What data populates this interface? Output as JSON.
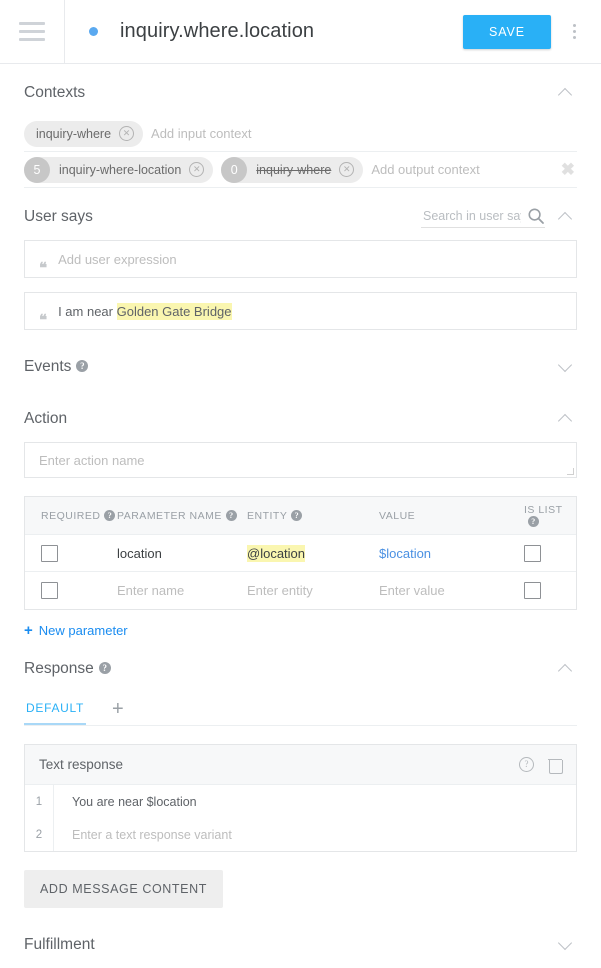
{
  "topbar": {
    "menu_icon": "hamburger-icon",
    "status_dot": "blue-dot",
    "title": "inquiry.where.location",
    "save_label": "SAVE",
    "more_icon": "kebab-menu-icon",
    "accent_color": "#29b0f6"
  },
  "contexts": {
    "title": "Contexts",
    "input_chips": [
      {
        "label": "inquiry-where",
        "badge": null,
        "strike": false
      }
    ],
    "input_placeholder": "Add input context",
    "output_chips": [
      {
        "label": "inquiry-where-location",
        "badge": "5",
        "strike": false
      },
      {
        "label": "inquiry-where",
        "badge": "0",
        "strike": true
      }
    ],
    "output_placeholder": "Add output context",
    "clear_icon": "close-icon"
  },
  "user_says": {
    "title": "User says",
    "search_placeholder": "Search in user says",
    "search_value": "",
    "add_expression_placeholder": "Add user expression",
    "expressions": [
      {
        "prefix": "I am near ",
        "highlight": "Golden Gate Bridge",
        "highlight_color": "#faf6b0"
      }
    ]
  },
  "events": {
    "title": "Events"
  },
  "action": {
    "title": "Action",
    "name_placeholder": "Enter action name",
    "name_value": "",
    "table": {
      "headers": [
        "REQUIRED",
        "PARAMETER NAME",
        "ENTITY",
        "VALUE",
        "IS LIST"
      ],
      "rows": [
        {
          "required": false,
          "name": "location",
          "name_is_placeholder": false,
          "entity": "@location",
          "entity_is_placeholder": false,
          "entity_highlight": true,
          "value": "$location",
          "value_is_placeholder": false,
          "value_is_link": true,
          "is_list": false
        },
        {
          "required": false,
          "name": "Enter name",
          "name_is_placeholder": true,
          "entity": "Enter entity",
          "entity_is_placeholder": true,
          "entity_highlight": false,
          "value": "Enter value",
          "value_is_placeholder": true,
          "value_is_link": false,
          "is_list": false
        }
      ]
    },
    "new_parameter_label": "New parameter"
  },
  "response": {
    "title": "Response",
    "tabs": [
      {
        "label": "DEFAULT",
        "active": true
      }
    ],
    "add_tab_icon": "plus-icon",
    "card": {
      "title": "Text response",
      "help_icon": "help-icon",
      "delete_icon": "trash-icon",
      "rows": [
        {
          "num": "1",
          "text": "You are near $location",
          "is_placeholder": false
        },
        {
          "num": "2",
          "text": "Enter a text response variant",
          "is_placeholder": true
        }
      ]
    },
    "add_message_label": "ADD MESSAGE CONTENT"
  },
  "fulfillment": {
    "title": "Fulfillment"
  }
}
